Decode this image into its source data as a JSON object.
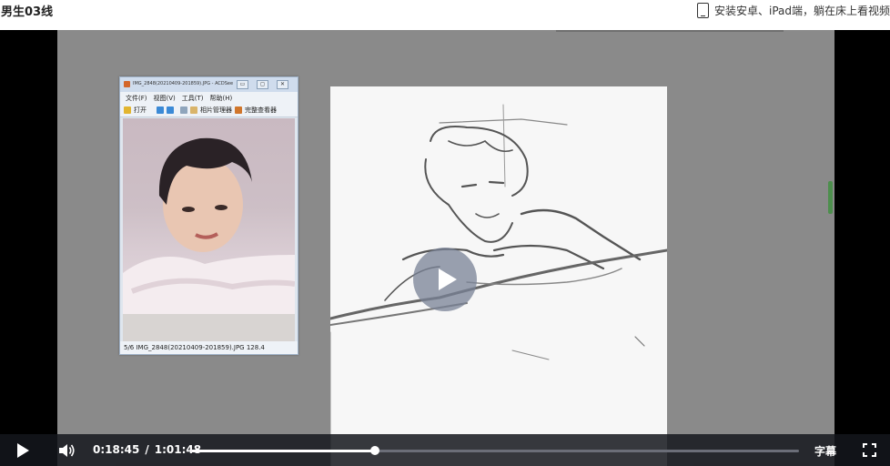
{
  "header": {
    "title": "男生03线",
    "install_text": "安装安卓、iPad端，躺在床上看视频"
  },
  "acdsee": {
    "title": "IMG_2848(20210409-201859).JPG - ACDSee",
    "window_buttons": [
      "▭",
      "◻",
      "✕"
    ],
    "menu": [
      "文件(F)",
      "视图(V)",
      "工具(T)",
      "帮助(H)"
    ],
    "toolbar": {
      "open": "打开",
      "photo_manager": "相片管理器",
      "full_viewer": "完整查看器"
    },
    "status": "5/6   IMG_2848(20210409-201859).JPG   128.4"
  },
  "player": {
    "current_time": "0:18:45",
    "separator": "/",
    "duration": "1:01:48",
    "progress": 0.303,
    "subtitle_label": "字幕"
  },
  "colors": {
    "stage": "#8a8a8a",
    "controls_bg": "#14161c",
    "accent_scroll": "#4d8f4d"
  },
  "icons": {
    "play": "play-icon",
    "volume": "volume-icon",
    "fullscreen": "fullscreen-icon",
    "tablet": "tablet-icon"
  }
}
